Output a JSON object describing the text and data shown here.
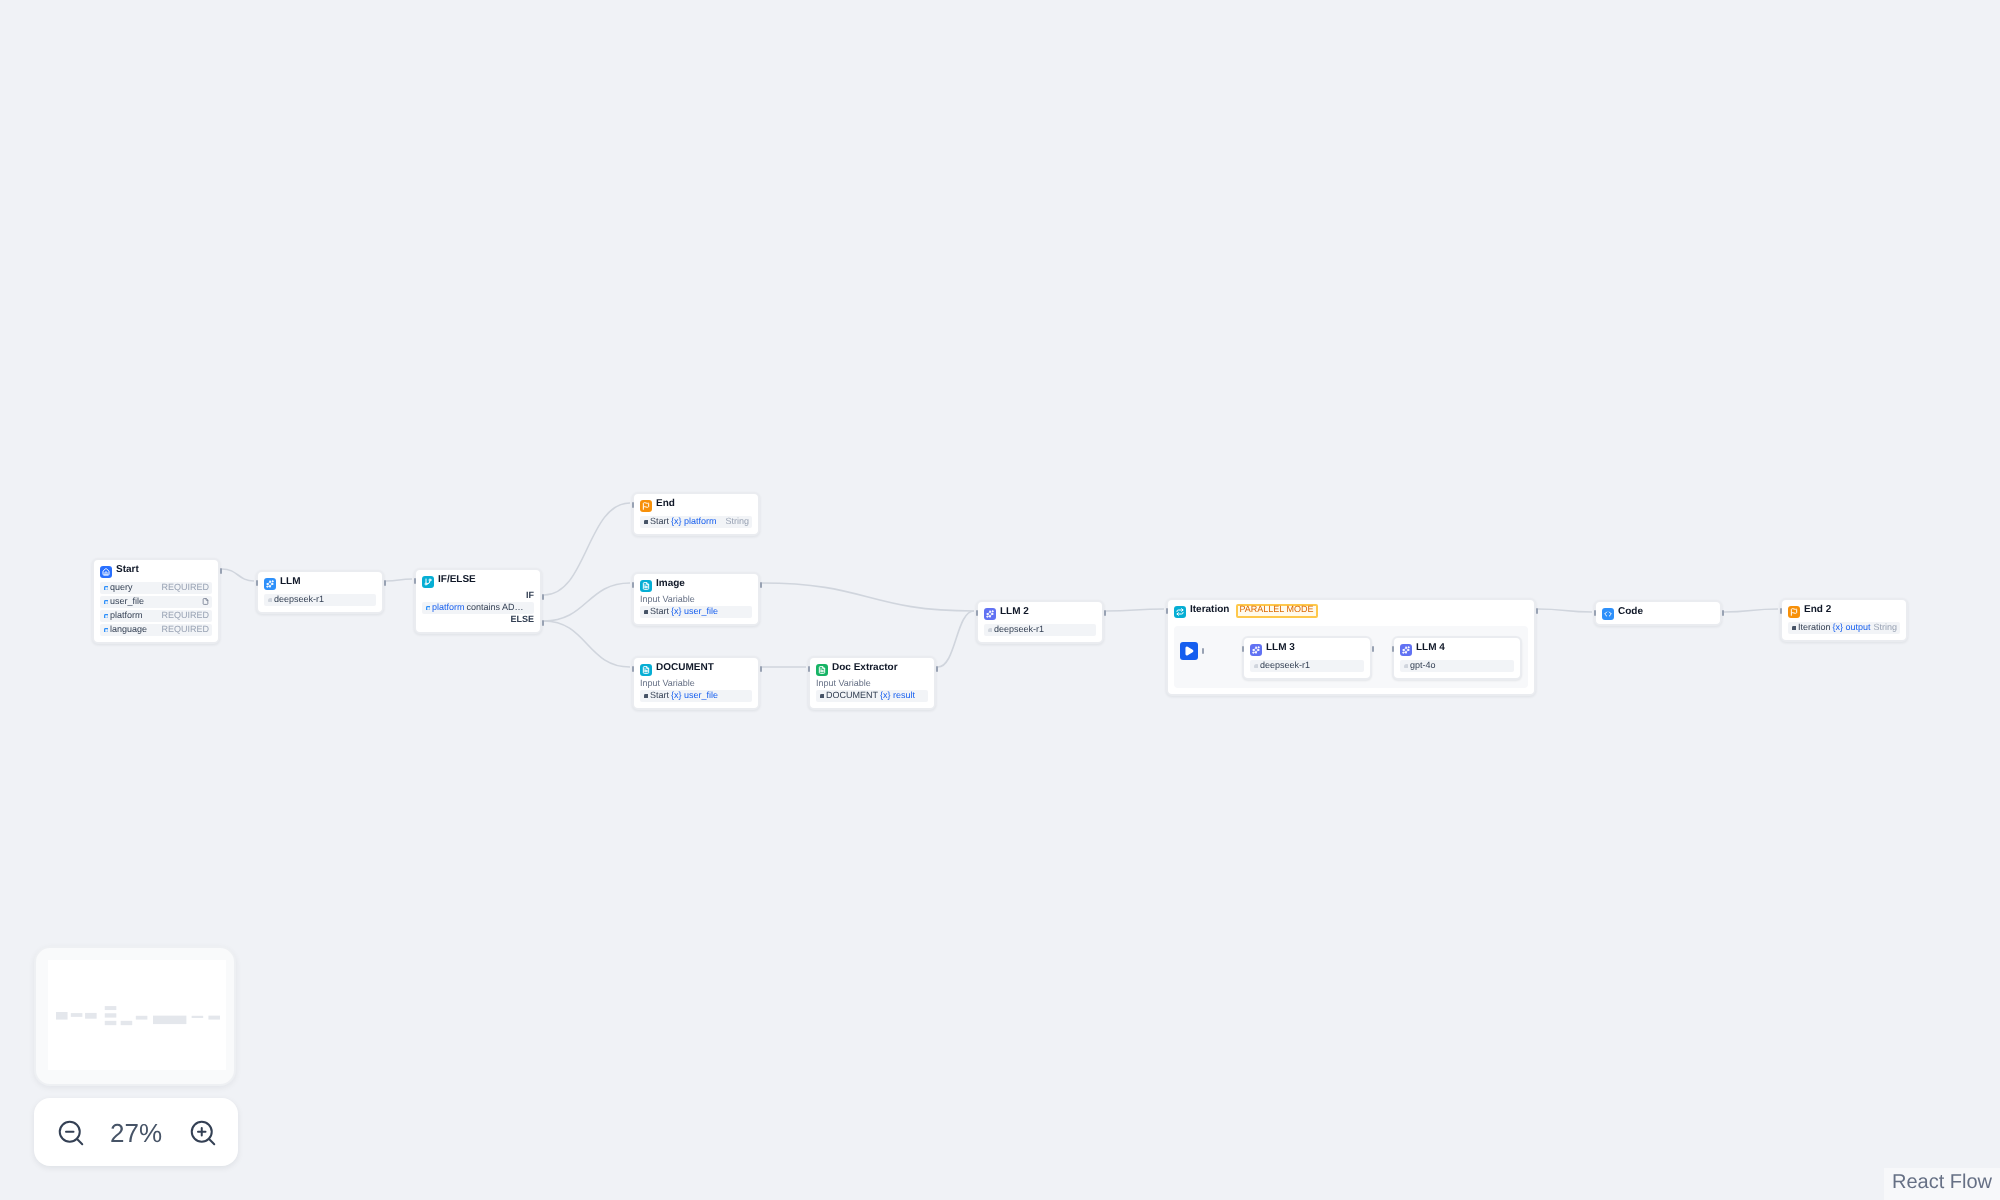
{
  "workflow": {
    "nodes": [
      {
        "kind": "start",
        "title": "Start",
        "color": "#2970ff",
        "variables": [
          {
            "name": "query",
            "kind": "text",
            "tag": "REQUIRED"
          },
          {
            "name": "user_file",
            "kind": "file"
          },
          {
            "name": "platform",
            "kind": "text",
            "tag": "REQUIRED"
          },
          {
            "name": "language",
            "kind": "text",
            "tag": "REQUIRED"
          }
        ]
      },
      {
        "kind": "llm",
        "title": "LLM",
        "color": "#2e90fa",
        "model": "deepseek-r1"
      },
      {
        "kind": "if_else",
        "title": "IF/ELSE",
        "color": "#06aed4",
        "if_label": "IF",
        "condition": {
          "variable": "platform",
          "operator": "contains",
          "value": "AD…"
        },
        "else_label": "ELSE"
      },
      {
        "kind": "end",
        "title": "End",
        "color": "#f79009",
        "outputs": [
          {
            "source": "Start",
            "variable": "{x} platform",
            "type": "String"
          }
        ]
      },
      {
        "kind": "input_node",
        "title": "Image",
        "color": "#06aed4",
        "subtitle": "Input Variable",
        "input": {
          "source": "Start",
          "variable": "{x} user_file"
        }
      },
      {
        "kind": "input_node",
        "title": "DOCUMENT",
        "color": "#06aed4",
        "subtitle": "Input Variable",
        "input": {
          "source": "Start",
          "variable": "{x} user_file"
        }
      },
      {
        "kind": "input_node",
        "title": "Doc Extractor",
        "color": "#16b364",
        "subtitle": "Input Variable",
        "input": {
          "source": "DOCUMENT",
          "variable": "{x} result"
        }
      },
      {
        "kind": "llm",
        "title": "LLM 2",
        "color": "#6172f3",
        "model": "deepseek-r1"
      },
      {
        "kind": "iteration",
        "title": "Iteration",
        "color": "#06aed4",
        "badge": "PARALLEL MODE",
        "children": [
          {
            "kind": "iteration_start",
            "color": "#155eef"
          },
          {
            "kind": "llm",
            "title": "LLM 3",
            "color": "#6172f3",
            "model": "deepseek-r1"
          },
          {
            "kind": "llm",
            "title": "LLM 4",
            "color": "#6172f3",
            "model": "gpt-4o"
          }
        ]
      },
      {
        "kind": "code",
        "title": "Code",
        "color": "#2e90fa"
      },
      {
        "kind": "end",
        "title": "End 2",
        "color": "#f79009",
        "outputs": [
          {
            "source": "Iteration",
            "variable": "{x} output",
            "type": "String"
          }
        ]
      }
    ]
  },
  "zoom_controls": {
    "zoom_level": "27%"
  },
  "attribution": "React Flow"
}
